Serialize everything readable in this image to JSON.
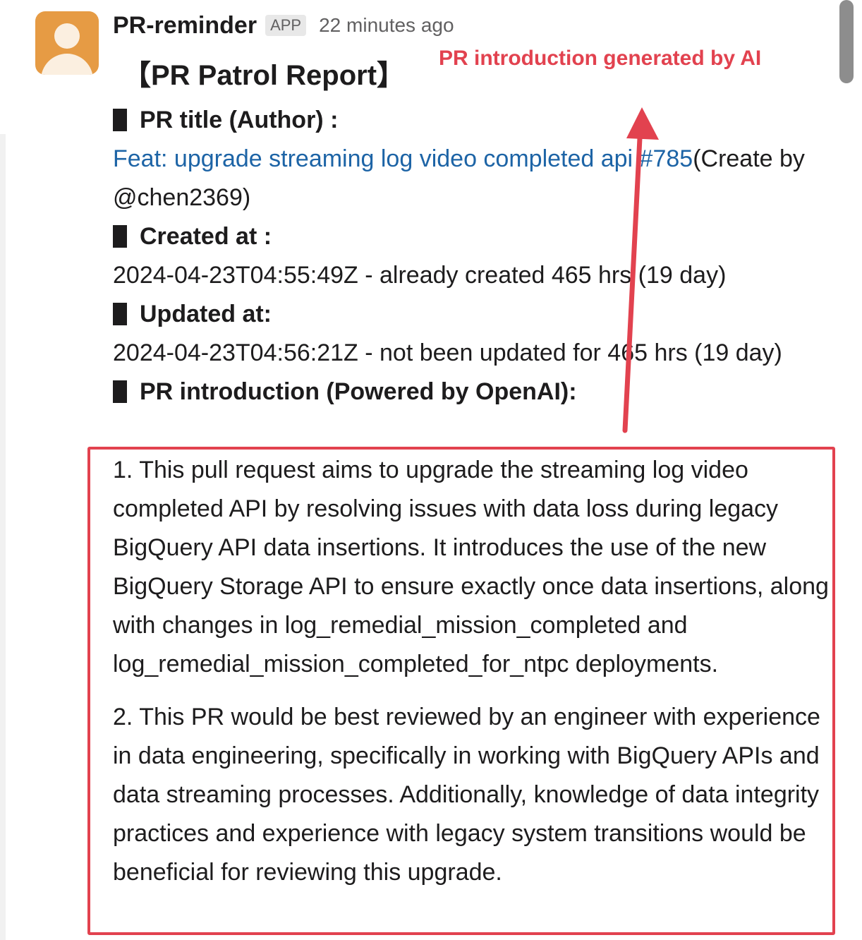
{
  "message": {
    "bot_name": "PR-reminder",
    "app_badge": "APP",
    "timestamp": "22 minutes ago",
    "report_title": "【PR Patrol Report】"
  },
  "annotation": {
    "label": "PR introduction generated by AI",
    "color": "#e2424f"
  },
  "report": {
    "pr_title_label": "PR title (Author) :",
    "pr_link_text": "Feat: upgrade streaming log video completed api #785",
    "pr_author_text": "(Create by @chen2369)",
    "created_label": "Created at :",
    "created_value": "2024-04-23T04:55:49Z - already created 465 hrs (19 day)",
    "updated_label": "Updated at:",
    "updated_value": "2024-04-23T04:56:21Z - not been updated for 465 hrs  (19 day)",
    "intro_label": "PR introduction (Powered by OpenAI):",
    "intro_paragraph_1": "1. This pull request aims to upgrade the streaming log video completed API by resolving issues with data loss during legacy BigQuery API data insertions. It introduces the use of the new BigQuery Storage API to ensure exactly once data insertions, along with changes in log_remedial_mission_completed and log_remedial_mission_completed_for_ntpc deployments.",
    "intro_paragraph_2": "2. This PR would be best reviewed by an engineer with experience in data engineering, specifically in working with BigQuery APIs and data streaming processes. Additionally, knowledge of data integrity practices and experience with legacy system transitions would be beneficial for reviewing this upgrade."
  },
  "icons": {
    "avatar": "user-avatar-icon",
    "arrow": "arrow-up-annotation-icon"
  },
  "colors": {
    "link": "#1d64a6",
    "avatar_bg": "#e69b44",
    "highlight": "#e2424f"
  }
}
